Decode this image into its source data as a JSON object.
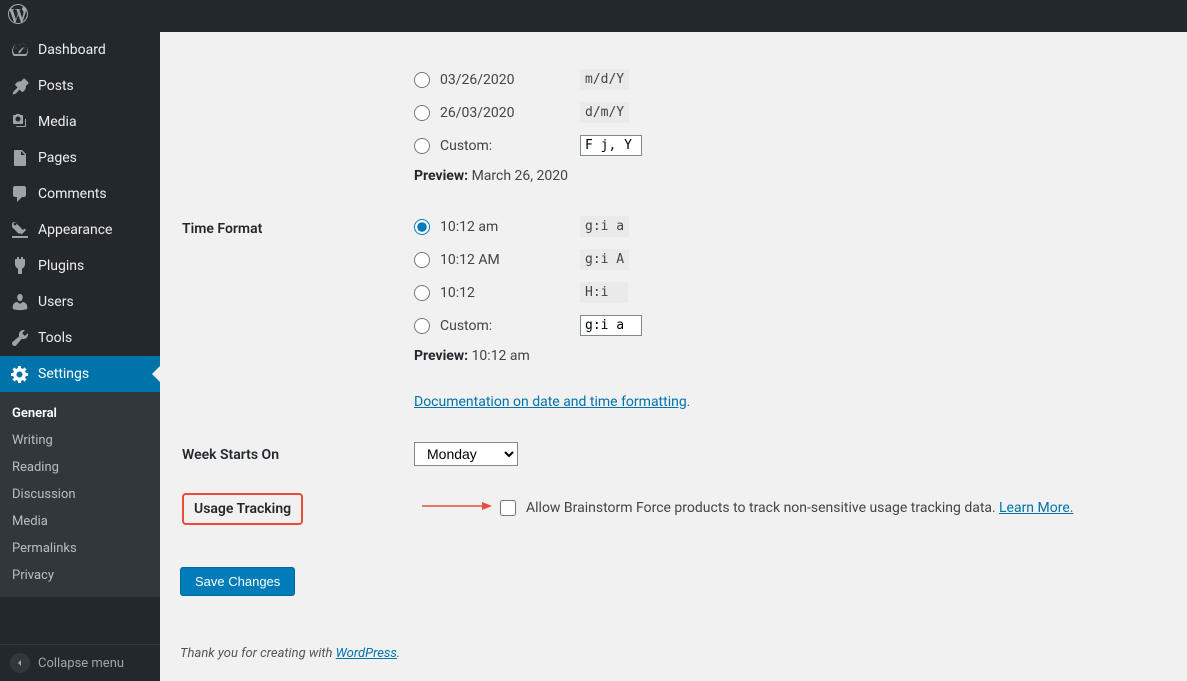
{
  "sidebar": {
    "items": [
      {
        "icon": "dashboard",
        "label": "Dashboard"
      },
      {
        "icon": "pin",
        "label": "Posts"
      },
      {
        "icon": "media",
        "label": "Media"
      },
      {
        "icon": "pages",
        "label": "Pages"
      },
      {
        "icon": "comments",
        "label": "Comments"
      },
      {
        "icon": "appearance",
        "label": "Appearance"
      },
      {
        "icon": "plugins",
        "label": "Plugins"
      },
      {
        "icon": "users",
        "label": "Users"
      },
      {
        "icon": "tools",
        "label": "Tools"
      },
      {
        "icon": "settings",
        "label": "Settings"
      }
    ],
    "submenu": [
      {
        "label": "General"
      },
      {
        "label": "Writing"
      },
      {
        "label": "Reading"
      },
      {
        "label": "Discussion"
      },
      {
        "label": "Media"
      },
      {
        "label": "Permalinks"
      },
      {
        "label": "Privacy"
      }
    ],
    "collapse": "Collapse menu"
  },
  "date_format": {
    "options": [
      {
        "label": "03/26/2020",
        "code": "m/d/Y",
        "checked": false
      },
      {
        "label": "26/03/2020",
        "code": "d/m/Y",
        "checked": false
      }
    ],
    "custom_label": "Custom:",
    "custom_value": "F j, Y",
    "preview_label": "Preview:",
    "preview_value": "March 26, 2020"
  },
  "time_format": {
    "heading": "Time Format",
    "options": [
      {
        "label": "10:12 am",
        "code": "g:i a",
        "checked": true
      },
      {
        "label": "10:12 AM",
        "code": "g:i A",
        "checked": false
      },
      {
        "label": "10:12",
        "code": "H:i",
        "checked": false
      }
    ],
    "custom_label": "Custom:",
    "custom_value": "g:i a",
    "preview_label": "Preview:",
    "preview_value": "10:12 am",
    "doc_link": "Documentation on date and time formatting"
  },
  "week": {
    "heading": "Week Starts On",
    "value": "Monday"
  },
  "usage": {
    "heading": "Usage Tracking",
    "label": "Allow Brainstorm Force products to track non-sensitive usage tracking data.",
    "link": "Learn More."
  },
  "save": "Save Changes",
  "footer": {
    "text": "Thank you for creating with ",
    "link": "WordPress"
  }
}
